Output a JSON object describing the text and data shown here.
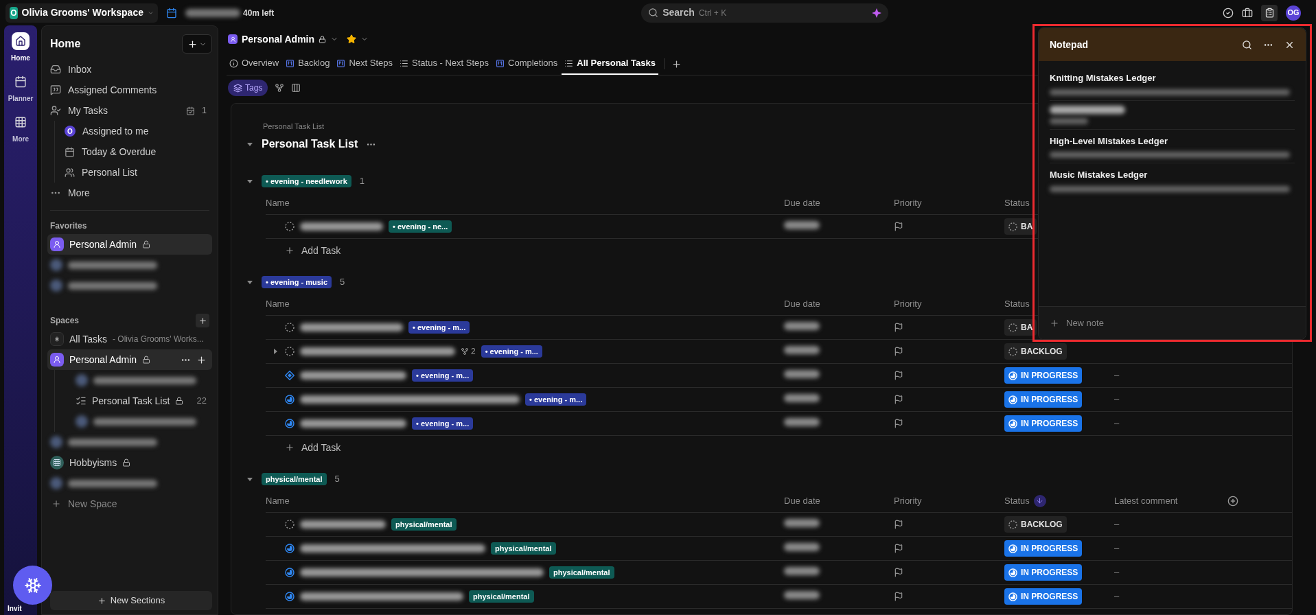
{
  "topbar": {
    "workspace": {
      "initial": "O",
      "name": "Olivia Grooms' Workspace"
    },
    "timer": "40m left",
    "search": {
      "placeholder": "Search",
      "shortcut": "Ctrl + K"
    },
    "avatar": "OG"
  },
  "rail": [
    {
      "label": "Home",
      "kind": "home",
      "selected": true
    },
    {
      "label": "Planner",
      "kind": "planner",
      "selected": false
    },
    {
      "label": "More",
      "kind": "more",
      "selected": false
    }
  ],
  "rail_footer": "Invit",
  "sidebar": {
    "title": "Home",
    "nav": [
      {
        "label": "Inbox",
        "kind": "inbox"
      },
      {
        "label": "Assigned Comments",
        "kind": "comments"
      },
      {
        "label": "My Tasks",
        "kind": "tasks",
        "count": "1",
        "children": [
          {
            "label": "Assigned to me",
            "kind": "avatar",
            "initial": "O"
          },
          {
            "label": "Today & Overdue",
            "kind": "calendar"
          },
          {
            "label": "Personal List",
            "kind": "people"
          }
        ]
      },
      {
        "label": "More",
        "kind": "more"
      }
    ],
    "favorites": {
      "heading": "Favorites",
      "items": [
        {
          "kind": "space",
          "label": "Personal Admin",
          "locked": true,
          "selected": true
        },
        {
          "kind": "blurred"
        },
        {
          "kind": "blurred"
        }
      ]
    },
    "spaces": {
      "heading": "Spaces",
      "items": [
        {
          "kind": "all",
          "label": "All Tasks",
          "subtitle": "- Olivia Grooms' Works...",
          "selected": false
        },
        {
          "kind": "space",
          "label": "Personal Admin",
          "locked": true,
          "selected": true,
          "children": [
            {
              "kind": "blurred"
            },
            {
              "kind": "list",
              "label": "Personal Task List",
              "locked": true,
              "count": "22"
            },
            {
              "kind": "blurred"
            }
          ]
        },
        {
          "kind": "blurred"
        },
        {
          "kind": "grid",
          "label": "Hobbyisms",
          "locked": true,
          "selected": false
        },
        {
          "kind": "blurred"
        }
      ],
      "new_space": "New Space"
    },
    "footer_button": "New Sections"
  },
  "main": {
    "breadcrumb": {
      "label": "Personal Admin",
      "locked": true
    },
    "tabs": [
      {
        "label": "Overview",
        "kind": "info",
        "selected": false
      },
      {
        "label": "Backlog",
        "kind": "board",
        "selected": false
      },
      {
        "label": "Next Steps",
        "kind": "board",
        "selected": false
      },
      {
        "label": "Status - Next Steps",
        "kind": "list",
        "selected": false
      },
      {
        "label": "Completions",
        "kind": "board",
        "selected": false
      },
      {
        "label": "All Personal Tasks",
        "kind": "list",
        "selected": true
      }
    ],
    "toolbar": {
      "label": "Tags",
      "selected": true
    },
    "list": {
      "caption": "Personal Task List",
      "title": "Personal Task List"
    },
    "groups": [
      {
        "tag": "• evening - needlework",
        "color": "#0e5a54",
        "count": "1",
        "columns": [
          "Name",
          "Due date",
          "Priority",
          "Status"
        ],
        "add": "Add Task",
        "rows": [
          {
            "kind": "todo",
            "tag": "• evening - ne...",
            "status": {
              "text": "BA",
              "kind": "backlog"
            }
          }
        ]
      },
      {
        "tag": "• evening - music",
        "color": "#2b3a9a",
        "count": "5",
        "columns": [
          "Name",
          "Due date",
          "Priority",
          "Status"
        ],
        "add": "Add Task",
        "rows": [
          {
            "kind": "todo",
            "tag": "• evening - m...",
            "status": {
              "text": "BA",
              "kind": "backlog"
            }
          },
          {
            "kind": "todo",
            "tag": "• evening - m...",
            "subtasks": "2",
            "expandable": true,
            "status": {
              "text": "BACKLOG",
              "kind": "backlog"
            }
          },
          {
            "kind": "diamond",
            "tag": "• evening - m...",
            "status": {
              "text": "IN PROGRESS",
              "kind": "progress"
            },
            "comment": "–"
          },
          {
            "kind": "progress",
            "tag": "• evening - m...",
            "status": {
              "text": "IN PROGRESS",
              "kind": "progress"
            },
            "comment": "–"
          },
          {
            "kind": "progress",
            "tag": "• evening - m...",
            "status": {
              "text": "IN PROGRESS",
              "kind": "progress"
            },
            "comment": "–"
          }
        ]
      },
      {
        "tag": "physical/mental",
        "color": "#0e5a54",
        "count": "5",
        "columns": [
          "Name",
          "Due date",
          "Priority",
          "Status",
          "Latest comment"
        ],
        "rows": [
          {
            "kind": "todo",
            "tag": "physical/mental",
            "status": {
              "text": "BACKLOG",
              "kind": "backlog"
            },
            "comment": "–"
          },
          {
            "kind": "progress",
            "tag": "physical/mental",
            "status": {
              "text": "IN PROGRESS",
              "kind": "progress"
            },
            "comment": "–"
          },
          {
            "kind": "progress",
            "tag": "physical/mental",
            "status": {
              "text": "IN PROGRESS",
              "kind": "progress"
            },
            "comment": "–"
          },
          {
            "kind": "progress",
            "tag": "physical/mental",
            "status": {
              "text": "IN PROGRESS",
              "kind": "progress"
            },
            "comment": "–"
          }
        ]
      }
    ]
  },
  "notepad": {
    "title": "Notepad",
    "highlighted": true,
    "notes": [
      {
        "title": "Knitting Mistakes Ledger"
      },
      {
        "kind": "blurred"
      },
      {
        "title": "High-Level Mistakes Ledger"
      },
      {
        "title": "Music Mistakes Ledger"
      }
    ],
    "new_note": "New note"
  }
}
